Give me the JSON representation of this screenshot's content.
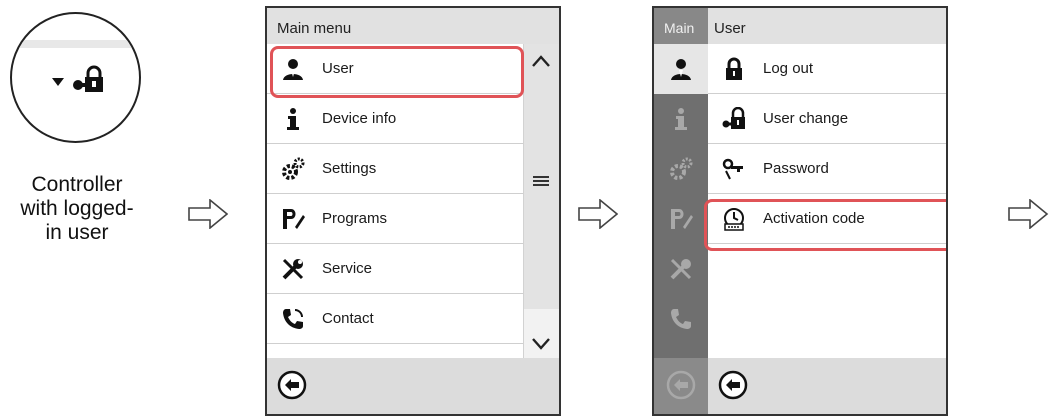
{
  "caption": {
    "line1": "Controller",
    "line2": "with logged-",
    "line3": "in user"
  },
  "panel1": {
    "header": "Main menu",
    "items": [
      {
        "icon": "user-icon",
        "label": "User"
      },
      {
        "icon": "info-icon",
        "label": "Device info"
      },
      {
        "icon": "settings-gears-icon",
        "label": "Settings"
      },
      {
        "icon": "programs-icon",
        "label": "Programs"
      },
      {
        "icon": "service-tools-icon",
        "label": "Service"
      },
      {
        "icon": "contact-phone-icon",
        "label": "Contact"
      }
    ],
    "highlighted": "User"
  },
  "panel2": {
    "sidebar_header": "Main",
    "header": "User",
    "items": [
      {
        "icon": "padlock-icon",
        "label": "Log out"
      },
      {
        "icon": "user-change-icon",
        "label": "User change"
      },
      {
        "icon": "password-key-icon",
        "label": "Password"
      },
      {
        "icon": "activation-code-icon",
        "label": "Activation code"
      }
    ],
    "highlighted": "Activation code"
  },
  "colors": {
    "highlight": "#e05357",
    "header_bg": "#e1e1e1",
    "sidebar_bg": "#6f6f6f"
  }
}
